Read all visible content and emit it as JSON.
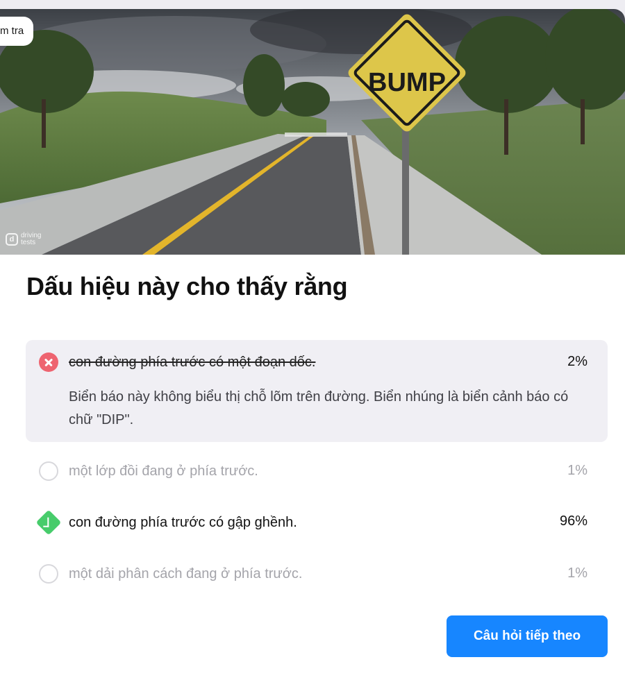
{
  "hero": {
    "tag_label": "m tra",
    "sign_text": "BUMP",
    "watermark": "driving tests"
  },
  "question": {
    "title": "Dấu hiệu này cho thấy rằng"
  },
  "options": [
    {
      "text": "con đường phía trước có một đoạn dốc.",
      "percent": "2%",
      "state": "wrong",
      "explanation": "Biển báo này không biểu thị chỗ lõm trên đường. Biển nhúng là biển cảnh báo có chữ \"DIP\"."
    },
    {
      "text": "một lớp đồi đang ở phía trước.",
      "percent": "1%",
      "state": "unselected"
    },
    {
      "text": "con đường phía trước có gập ghềnh.",
      "percent": "96%",
      "state": "correct"
    },
    {
      "text": "một dải phân cách đang ở phía trước.",
      "percent": "1%",
      "state": "unselected"
    }
  ],
  "actions": {
    "next_label": "Câu hỏi tiếp theo"
  },
  "colors": {
    "wrong": "#ee6470",
    "correct": "#47cc6b",
    "primary_button": "#1786ff",
    "expanded_bg": "#f0eff4"
  }
}
